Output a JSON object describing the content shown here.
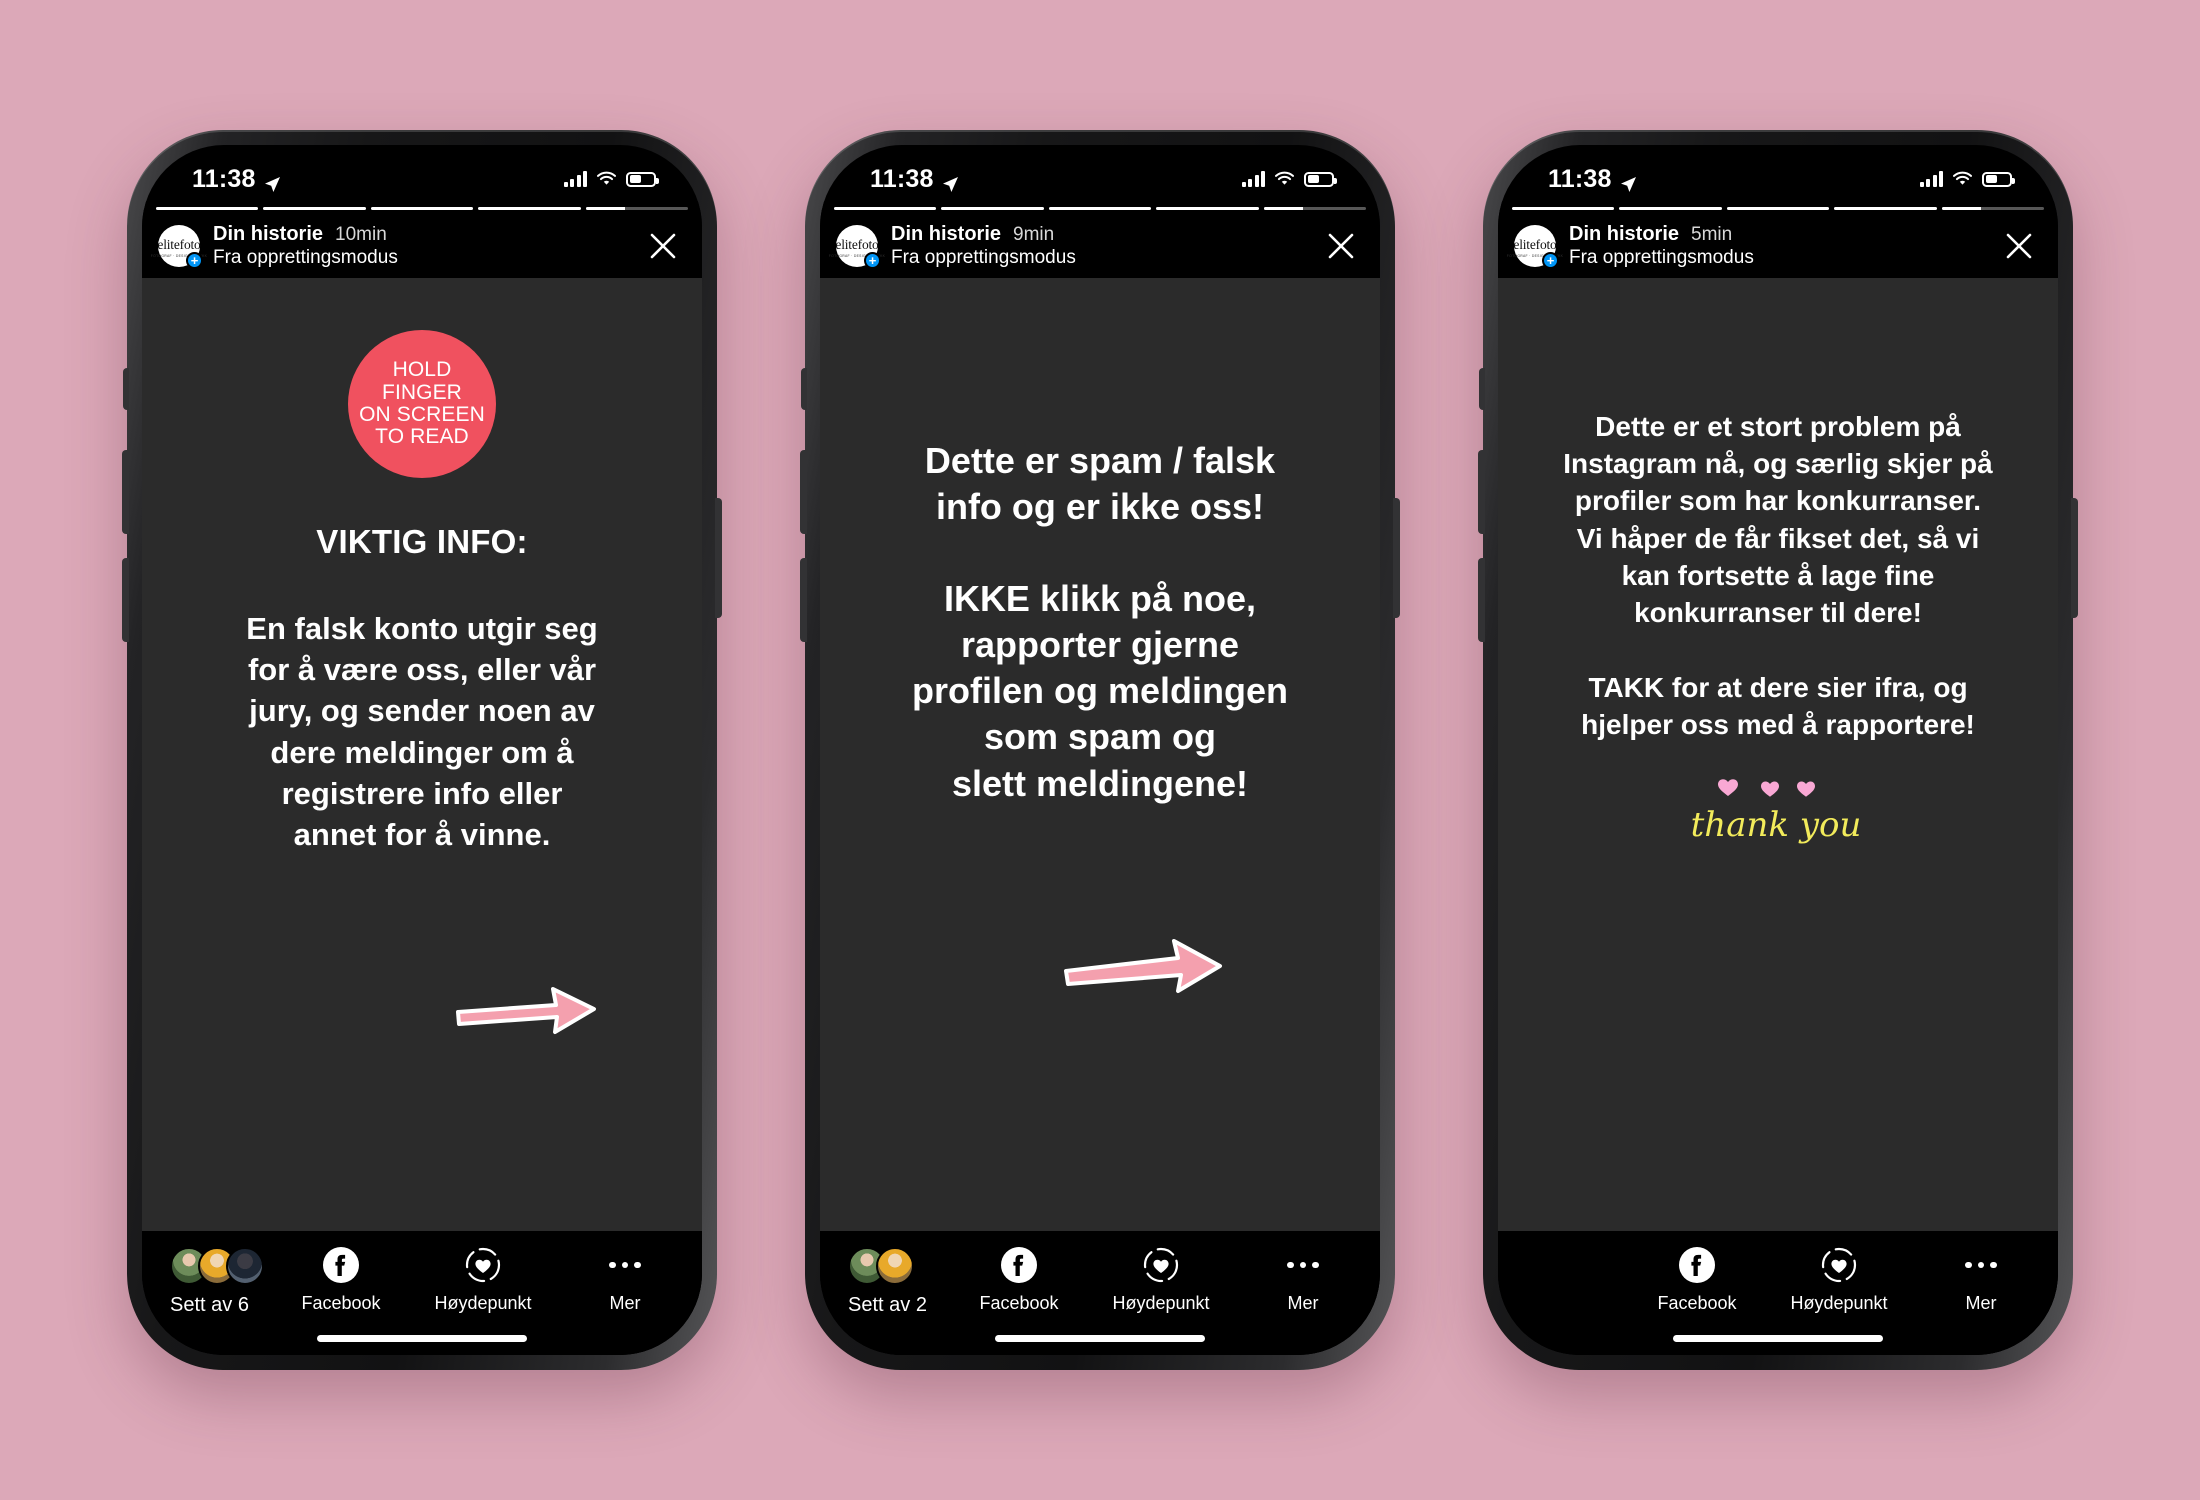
{
  "background_color": "#DCA8B8",
  "status_bar": {
    "time": "11:38",
    "location_icon": "location-arrow-icon",
    "signal_icon": "cellular-signal-icon",
    "wifi_icon": "wifi-icon",
    "battery_icon": "battery-icon"
  },
  "common": {
    "account_name": "Din historie",
    "account_subtitle": "Fra opprettingsmodus",
    "avatar_logo_text": "elitefoto",
    "avatar_logo_subtext": "FOTOGRAF · DESIGN · TRYKK",
    "add_badge": "+",
    "close_label": "close-icon",
    "facebook_label": "Facebook",
    "highlight_label": "Høydepunkt",
    "more_label": "Mer",
    "progress_segments": 5,
    "progress_active_index": 5,
    "progress_active_percent": 38,
    "arrow_color": "#F4A0AE",
    "arrow_outline_color": "#FFFFFF"
  },
  "phones": [
    {
      "id": "phone-1",
      "timestamp": "10min",
      "badge": {
        "color": "#F0515F",
        "lines": [
          "HOLD",
          "FINGER",
          "ON SCREEN",
          "TO READ"
        ]
      },
      "title": "VIKTIG INFO:",
      "body_lines": [
        "En falsk konto utgir seg",
        "for å være oss, eller vår",
        "jury, og sender noen av",
        "dere meldinger om å",
        "registrere info eller",
        "annet for å vinne."
      ],
      "has_arrow": true,
      "viewers_label": "Sett av 6",
      "viewer_avatars": 3
    },
    {
      "id": "phone-2",
      "timestamp": "9min",
      "badge": null,
      "title": "",
      "body_lines": [
        "Dette er spam / falsk",
        "info og er ikke oss!",
        "",
        "IKKE klikk på noe,",
        "rapporter gjerne",
        "profilen og meldingen",
        "som spam og",
        "slett meldingene!"
      ],
      "has_arrow": true,
      "viewers_label": "Sett av 2",
      "viewer_avatars": 2
    },
    {
      "id": "phone-3",
      "timestamp": "5min",
      "badge": null,
      "title": "",
      "body_lines": [
        "Dette er et stort problem på",
        "Instagram nå, og særlig skjer på",
        "profiler som har konkurranser.",
        "Vi håper de får fikset det, så vi",
        "kan fortsette å lage fine",
        "konkurranser til dere!",
        "",
        "TAKK for at dere sier ifra, og",
        "hjelper oss med å rapportere!"
      ],
      "has_arrow": false,
      "sticker": {
        "text": "thank you",
        "text_color": "#F2EB5B",
        "heart_color": "#F9A8D4",
        "hearts": 3
      },
      "viewers_label": "",
      "viewer_avatars": 0
    }
  ]
}
